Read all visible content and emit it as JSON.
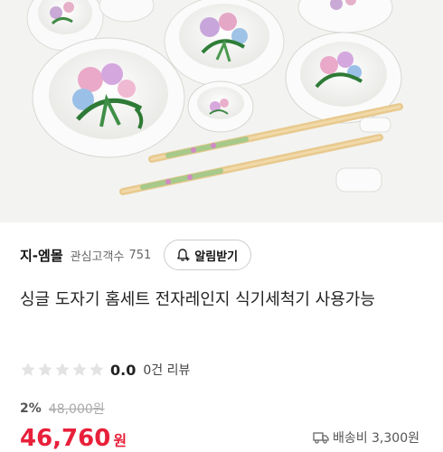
{
  "store": {
    "name": "지-엠몰",
    "followers_label": "관심고객수",
    "followers_count": "751",
    "alarm_button": "알림받기"
  },
  "product": {
    "title": "싱글 도자기 홈세트 전자레인지 식기세척기 사용가능",
    "rating": {
      "value": "0.0",
      "stars_filled": 0,
      "stars_total": 5,
      "review_count": "0건 리뷰"
    },
    "discount_rate": "2%",
    "original_price": "48,000원",
    "price": "46,760",
    "currency": "원",
    "shipping": "배송비 3,300원"
  },
  "image": {
    "icon": "porcelain-tableware-photo",
    "colors": {
      "background": "#f3f3f1",
      "accent": "#e8203a"
    }
  }
}
